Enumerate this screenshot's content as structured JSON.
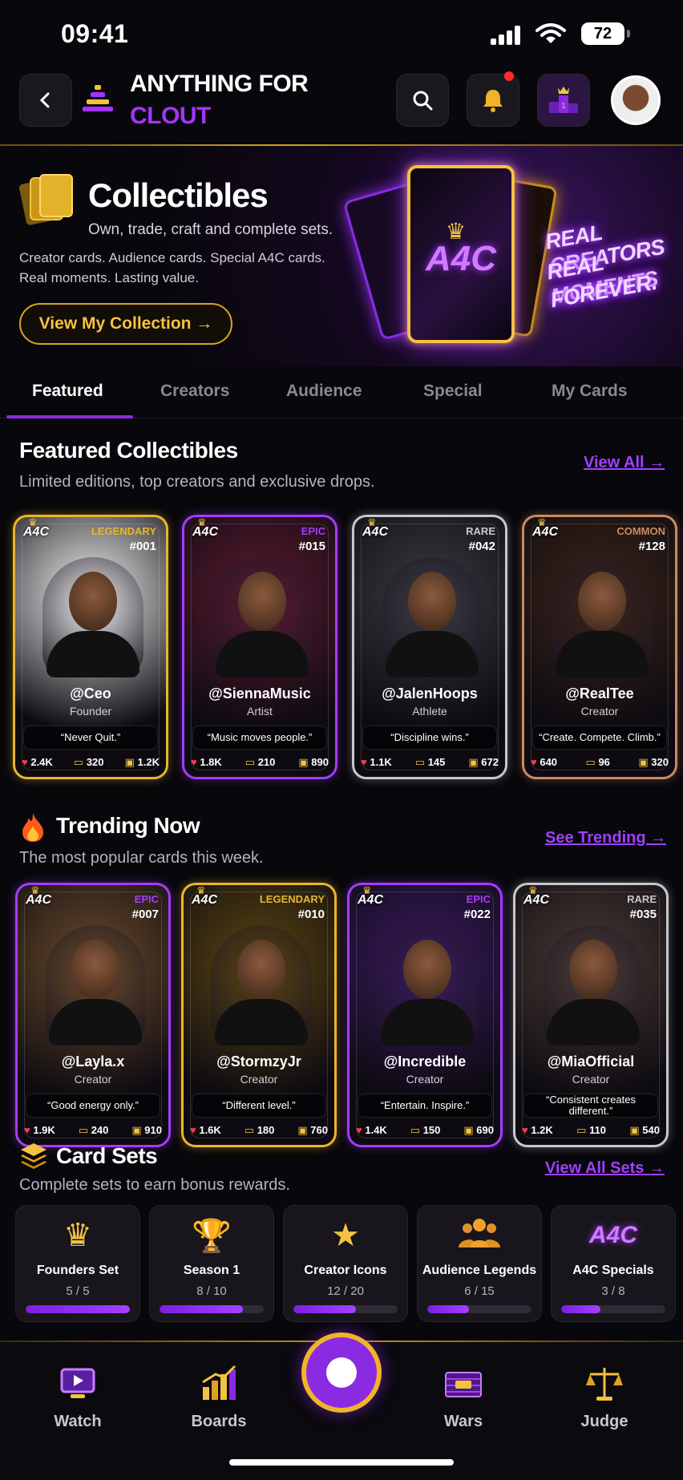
{
  "status_bar": {
    "time": "09:41",
    "battery": "72"
  },
  "header": {
    "brand_line1": "ANYTHING FOR",
    "brand_line2": "CLOUT"
  },
  "hero": {
    "title": "Collectibles",
    "subtitle": "Own, trade, craft and complete sets.",
    "line1": "Creator cards. Audience cards. Special A4C cards.",
    "line2": "Real moments. Lasting value.",
    "button": "View My Collection →",
    "card_logo": "A4C",
    "neon": [
      "REAL CREATORS",
      "REAL MOMENTS",
      "FOREVER."
    ]
  },
  "tabs": [
    "Featured",
    "Creators",
    "Audience",
    "Special",
    "My Cards"
  ],
  "featured": {
    "title": "Featured Collectibles",
    "subtitle": "Limited editions, top creators and exclusive drops.",
    "link": "View All →",
    "cards": [
      {
        "logo": "A4C",
        "rarity": "LEGENDARY",
        "number": "#001",
        "handle": "@Ceo",
        "role": "Founder",
        "quote": "“Never Quit.”",
        "likes": "2.4K",
        "comments": "320",
        "owners": "1.2K",
        "color": "#e8b62a"
      },
      {
        "logo": "A4C",
        "rarity": "EPIC",
        "number": "#015",
        "handle": "@SiennaMusic",
        "role": "Artist",
        "quote": "“Music moves people.”",
        "likes": "1.8K",
        "comments": "210",
        "owners": "890",
        "color": "#a43cff"
      },
      {
        "logo": "A4C",
        "rarity": "RARE",
        "number": "#042",
        "handle": "@JalenHoops",
        "role": "Athlete",
        "quote": "“Discipline wins.”",
        "likes": "1.1K",
        "comments": "145",
        "owners": "672",
        "color": "#c8c8cc"
      },
      {
        "logo": "A4C",
        "rarity": "COMMON",
        "number": "#128",
        "handle": "@RealTee",
        "role": "Creator",
        "quote": "“Create. Compete. Climb.”",
        "likes": "640",
        "comments": "96",
        "owners": "320",
        "color": "#c98b63"
      }
    ]
  },
  "trending": {
    "title": "Trending Now",
    "subtitle": "The most popular cards this week.",
    "link": "See Trending →",
    "cards": [
      {
        "logo": "A4C",
        "rarity": "EPIC",
        "number": "#007",
        "handle": "@Layla.x",
        "role": "Creator",
        "quote": "“Good energy only.”",
        "likes": "1.9K",
        "comments": "240",
        "owners": "910",
        "color": "#a43cff"
      },
      {
        "logo": "A4C",
        "rarity": "LEGENDARY",
        "number": "#010",
        "handle": "@StormzyJr",
        "role": "Creator",
        "quote": "“Different level.”",
        "likes": "1.6K",
        "comments": "180",
        "owners": "760",
        "color": "#e8b62a"
      },
      {
        "logo": "A4C",
        "rarity": "EPIC",
        "number": "#022",
        "handle": "@Incredible",
        "role": "Creator",
        "quote": "“Entertain. Inspire.”",
        "likes": "1.4K",
        "comments": "150",
        "owners": "690",
        "color": "#a43cff"
      },
      {
        "logo": "A4C",
        "rarity": "RARE",
        "number": "#035",
        "handle": "@MiaOfficial",
        "role": "Creator",
        "quote": "“Consistent creates different.”",
        "likes": "1.2K",
        "comments": "110",
        "owners": "540",
        "color": "#c8c8cc"
      }
    ]
  },
  "sets": {
    "title": "Card Sets",
    "subtitle": "Complete sets to earn bonus rewards.",
    "link": "View All Sets →",
    "items": [
      {
        "name": "Founders Set",
        "progress": "5 / 5",
        "fraction": 1.0
      },
      {
        "name": "Season 1",
        "progress": "8 / 10",
        "fraction": 0.8
      },
      {
        "name": "Creator Icons",
        "progress": "12 / 20",
        "fraction": 0.6
      },
      {
        "name": "Audience Legends",
        "progress": "6 / 15",
        "fraction": 0.4
      },
      {
        "name": "A4C Specials",
        "progress": "3 / 8",
        "fraction": 0.375
      }
    ]
  },
  "nav": {
    "watch": "Watch",
    "boards": "Boards",
    "wars": "Wars",
    "judge": "Judge"
  },
  "colors": {
    "accent": "#8a2be2",
    "gold": "#e8b62a"
  }
}
